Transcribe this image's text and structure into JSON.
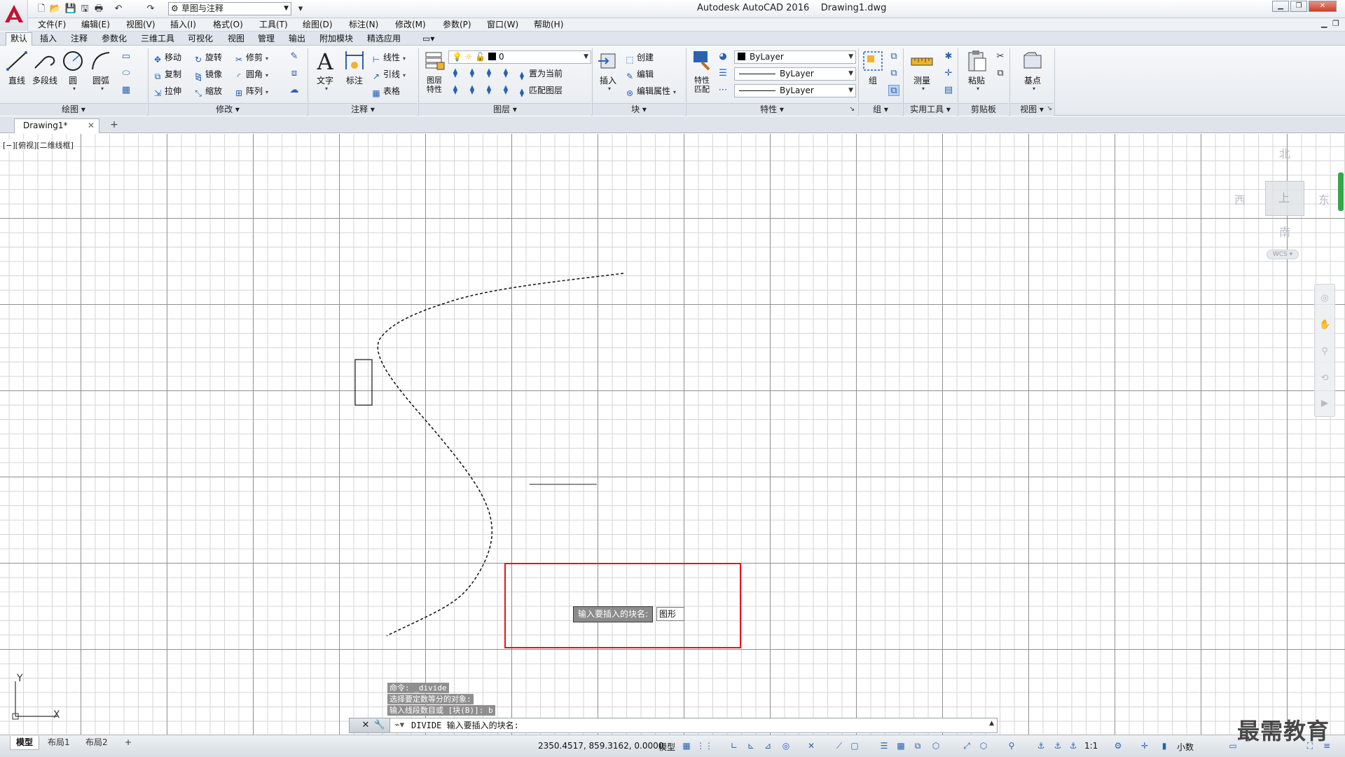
{
  "title_bar": {
    "app_title": "Autodesk AutoCAD 2016",
    "file_name": "Drawing1.dwg",
    "workspace": "草图与注释"
  },
  "menu": {
    "items": [
      "文件(F)",
      "编辑(E)",
      "视图(V)",
      "插入(I)",
      "格式(O)",
      "工具(T)",
      "绘图(D)",
      "标注(N)",
      "修改(M)",
      "参数(P)",
      "窗口(W)",
      "帮助(H)"
    ]
  },
  "ribbon_tabs": [
    "默认",
    "插入",
    "注释",
    "参数化",
    "三维工具",
    "可视化",
    "视图",
    "管理",
    "输出",
    "附加模块",
    "精选应用"
  ],
  "ribbon": {
    "draw": {
      "title": "绘图",
      "line": "直线",
      "polyline": "多段线",
      "circle": "圆",
      "arc": "圆弧"
    },
    "modify": {
      "title": "修改",
      "move": "移动",
      "rotate": "旋转",
      "trim": "修剪",
      "copy": "复制",
      "mirror": "镜像",
      "fillet": "圆角",
      "stretch": "拉伸",
      "scale": "缩放",
      "array": "阵列"
    },
    "annotation": {
      "title": "注释",
      "text": "文字",
      "dimension": "标注",
      "linear": "线性",
      "leader": "引线",
      "table": "表格"
    },
    "layers": {
      "title": "图层",
      "layer_properties": "图层\n特性",
      "current_layer": "0",
      "set_current": "置为当前",
      "match_layer": "匹配图层"
    },
    "block": {
      "title": "块",
      "insert": "插入",
      "create": "创建",
      "edit": "编辑",
      "edit_attributes": "编辑属性"
    },
    "properties": {
      "title": "特性",
      "match": "特性\n匹配",
      "color": "ByLayer",
      "linetype": "ByLayer",
      "lineweight": "ByLayer"
    },
    "groups": {
      "title": "组",
      "group": "组"
    },
    "utilities": {
      "title": "实用工具",
      "measure": "测量"
    },
    "clipboard": {
      "title": "剪贴板",
      "paste": "粘贴"
    },
    "view": {
      "title": "视图",
      "base": "基点"
    }
  },
  "file_tabs": {
    "active": "Drawing1*"
  },
  "viewport": {
    "label": "[−][俯视][二维线框]",
    "viewcube": {
      "north": "北",
      "south": "南",
      "east": "东",
      "west": "西",
      "top": "上",
      "wcs": "WCS"
    }
  },
  "dynamic_input": {
    "prompt": "输入要插入的块名:",
    "value": "图形"
  },
  "command_history": [
    "命令: _divide",
    "选择要定数等分的对象:",
    "输入线段数目或 [块(B)]: b"
  ],
  "command_line": {
    "text": "DIVIDE 输入要插入的块名:"
  },
  "ucs": {
    "x": "X",
    "y": "Y"
  },
  "status_bar": {
    "layouts": [
      "模型",
      "布局1",
      "布局2"
    ],
    "coordinates": "2350.4517, 859.3162, 0.0000",
    "mode": "模型",
    "scale": "1:1",
    "units": "小数"
  },
  "watermark": "最需教育",
  "colors": {
    "highlight": "#e8141b",
    "brand_red": "#c8102e"
  }
}
